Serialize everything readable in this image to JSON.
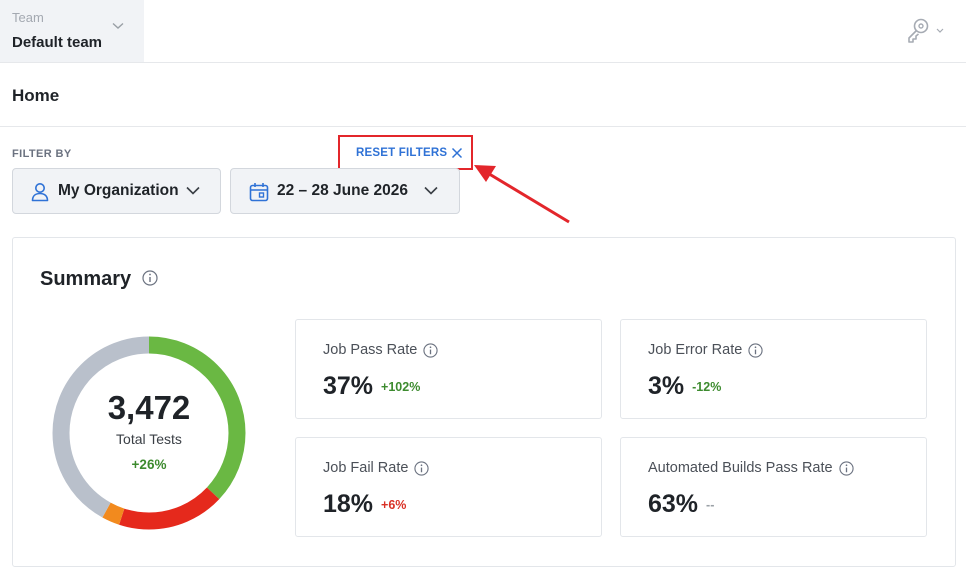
{
  "team": {
    "label": "Team",
    "value": "Default team"
  },
  "page": {
    "title": "Home"
  },
  "filters": {
    "label": "FILTER BY",
    "reset_label": "RESET FILTERS",
    "organization": "My Organization",
    "date_range": "22 – 28 June 2026"
  },
  "summary": {
    "title": "Summary",
    "total": "3,472",
    "total_label": "Total Tests",
    "total_delta": "+26%",
    "donut_segments": [
      {
        "name": "passed",
        "fraction": 0.37,
        "color": "#6ab843"
      },
      {
        "name": "failed",
        "fraction": 0.18,
        "color": "#e5291c"
      },
      {
        "name": "error",
        "fraction": 0.03,
        "color": "#f28a1e"
      },
      {
        "name": "other",
        "fraction": 0.42,
        "color": "#b9c0cb"
      }
    ],
    "metrics": [
      {
        "label": "Job Pass Rate",
        "value": "37%",
        "delta": "+102%"
      },
      {
        "label": "Job Error Rate",
        "value": "3%",
        "delta": "-12%"
      },
      {
        "label": "Job Fail Rate",
        "value": "18%",
        "delta": "+6%"
      },
      {
        "label": "Automated Builds Pass Rate",
        "value": "63%",
        "delta": "--"
      }
    ]
  },
  "colors": {
    "accent_link": "#2f72d6",
    "annotation_red": "#e3262b",
    "positive": "#3d8b2f",
    "negative": "#d93025"
  }
}
